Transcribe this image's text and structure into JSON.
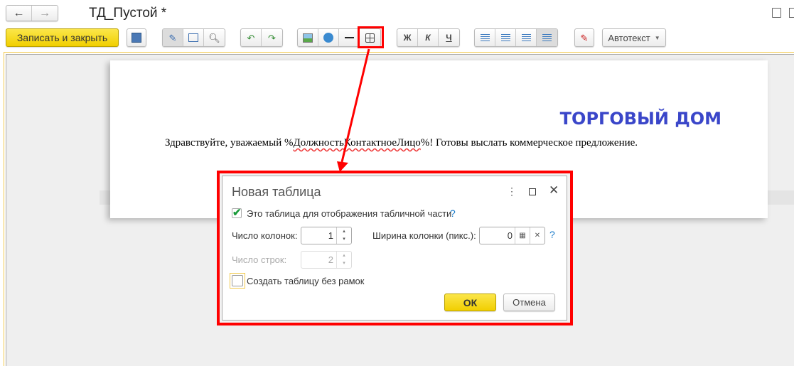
{
  "window": {
    "title": "ТД_Пустой *"
  },
  "toolbar": {
    "save_close_label": "Записать и закрыть",
    "bold_label": "Ж",
    "italic_label": "К",
    "underline_label": "Ч",
    "autotext_label": "Автотекст"
  },
  "document": {
    "heading": "ТОРГОВЫЙ ДОМ",
    "body_before": "Здравствуйте, уважаемый %",
    "body_field": "ДолжностьКонтактноеЛицо",
    "body_after": "%! Готовы выслать коммерческое предложение."
  },
  "dialog": {
    "title": "Новая таблица",
    "checkbox_tabular_label": "Это таблица для отображения табличной части",
    "checkbox_tabular_checked": true,
    "help": "?",
    "columns_label": "Число колонок:",
    "columns_value": "1",
    "width_label": "Ширина колонки (пикс.):",
    "width_value": "0",
    "rows_label": "Число строк:",
    "rows_value": "2",
    "no_border_label": "Создать таблицу без рамок",
    "no_border_checked": false,
    "ok_label": "ОК",
    "cancel_label": "Отмена"
  },
  "colors": {
    "accent_yellow": "#f5d90a",
    "highlight_red": "#ff0000",
    "heading_blue": "#3a46c9"
  }
}
